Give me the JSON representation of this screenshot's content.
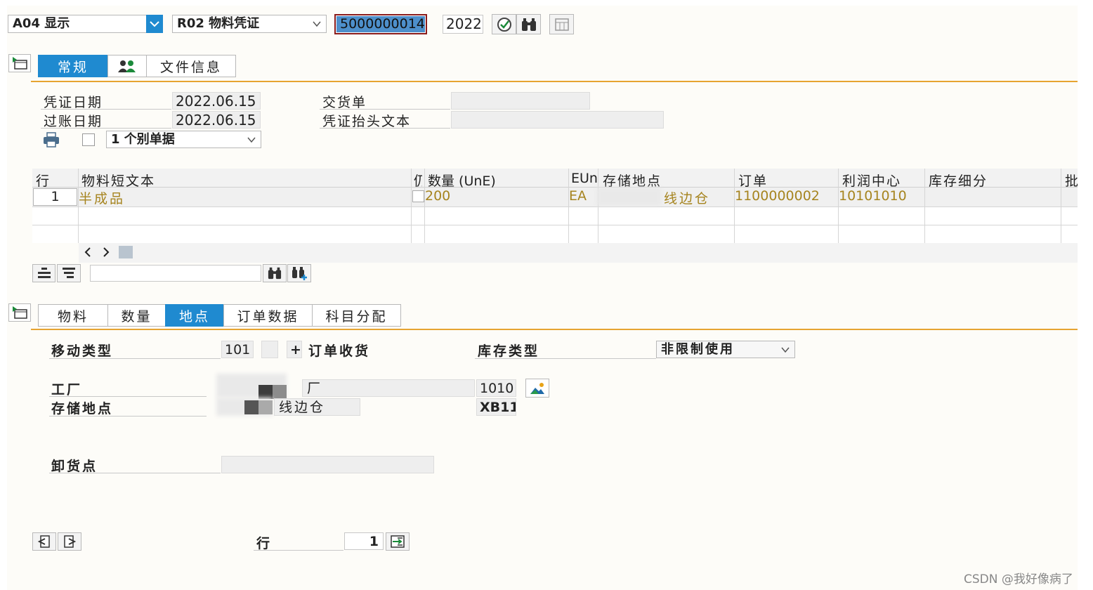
{
  "toolbar": {
    "action_value": "A04 显示",
    "reference_value": "R02 物料凭证",
    "document_number": "5000000014",
    "year": "2022"
  },
  "header_tabs": [
    {
      "label": "常规",
      "active": true
    },
    {
      "label": "",
      "icon": "partners-icon",
      "active": false
    },
    {
      "label": "文件信息",
      "active": false
    }
  ],
  "header": {
    "doc_date_label": "凭证日期",
    "doc_date_value": "2022.06.15",
    "post_date_label": "过账日期",
    "post_date_value": "2022.06.15",
    "delivery_label": "交货单",
    "delivery_value": "",
    "header_text_label": "凭证抬头文本",
    "header_text_value": "",
    "print_option_value": "1 个别单据"
  },
  "items_table": {
    "columns": [
      "行",
      "物料短文本",
      "仍",
      "数量 (UnE)",
      "EUn",
      "存储地点",
      "订单",
      "利润中心",
      "库存细分",
      "批"
    ],
    "rows": [
      {
        "line": "1",
        "material_text": "半成品",
        "quantity": "200",
        "unit": "EA",
        "storage_location": "线边仓",
        "order": "1100000002",
        "profit_center": "10101010",
        "stock_segment": ""
      }
    ],
    "search_value": ""
  },
  "detail_tabs": [
    {
      "label": "物料",
      "active": false
    },
    {
      "label": "数量",
      "active": false
    },
    {
      "label": "地点",
      "active": true
    },
    {
      "label": "订单数据",
      "active": false
    },
    {
      "label": "科目分配",
      "active": false
    }
  ],
  "detail": {
    "movement_type_label": "移动类型",
    "movement_type_value": "101",
    "movement_sign": "+",
    "movement_desc": "订单收货",
    "stock_type_label": "库存类型",
    "stock_type_value": "非限制使用",
    "plant_label": "工厂",
    "plant_name": "厂",
    "plant_code": "1010",
    "sloc_label": "存储地点",
    "sloc_name": "线边仓",
    "sloc_code": "XB11",
    "unloading_label": "卸货点",
    "unloading_value": ""
  },
  "footer": {
    "line_label": "行",
    "line_value": "1"
  },
  "watermark": "CSDN @我好像病了",
  "colors": {
    "accent_blue": "#1f8ad0",
    "gold_text": "#a6841f",
    "orange_rule": "#e6a431"
  }
}
